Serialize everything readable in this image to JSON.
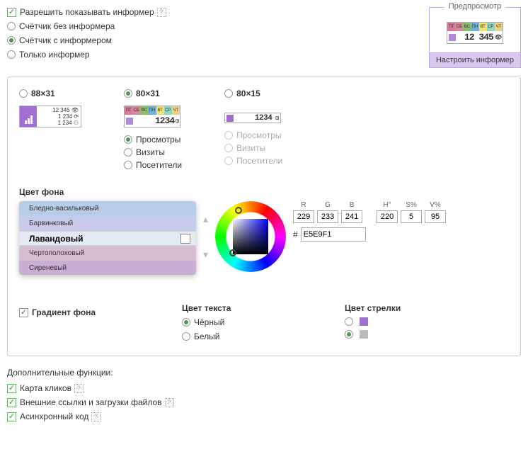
{
  "top": {
    "allow_informer": "Разрешить показывать информер",
    "counter_no_informer": "Счётчик без информера",
    "counter_with_informer": "Счётчик с информером",
    "informer_only": "Только информер"
  },
  "preview": {
    "title": "Предпросмотр",
    "number": "12 345",
    "days": [
      "ПТ",
      "СБ",
      "ВС",
      "ПН",
      "ВТ",
      "СР",
      "ЧТ"
    ],
    "day_colors": [
      "#d87aa0",
      "#d8889b",
      "#8cbf6a",
      "#6fb0d8",
      "#f5e26a",
      "#8fd8c8",
      "#f0d080"
    ],
    "button": "Настроить информер"
  },
  "sizes": {
    "s88": {
      "label": "88×31",
      "vals": [
        "12 345 👁",
        "1 234 ⟳",
        "1 234 ⚇"
      ]
    },
    "s80x31": {
      "label": "80×31",
      "number": "1234"
    },
    "s80x15": {
      "label": "80×15",
      "number": "1234"
    }
  },
  "metrics": {
    "views": "Просмотры",
    "visits": "Визиты",
    "visitors": "Посетители"
  },
  "bg": {
    "label": "Цвет фона",
    "swatches": [
      {
        "name": "Бледно-васильковый",
        "color": "#b6cce8"
      },
      {
        "name": "Барвинковый",
        "color": "#c7cceb"
      },
      {
        "name": "Лавандовый",
        "color": "#e5e9f1",
        "selected": true
      },
      {
        "name": "Чертополоховый",
        "color": "#d8bed3"
      },
      {
        "name": "Сиреневый",
        "color": "#c9aed4"
      }
    ],
    "rgb": {
      "r": "229",
      "g": "233",
      "b": "241"
    },
    "hsv": {
      "h": "220",
      "s": "5",
      "v": "95"
    },
    "labels": {
      "r": "R",
      "g": "G",
      "b": "B",
      "h": "H°",
      "s": "S%",
      "v": "V%"
    },
    "hex": "E5E9F1"
  },
  "bottom": {
    "gradient": "Градиент фона",
    "text_color": "Цвет текста",
    "black": "Чёрный",
    "white": "Белый",
    "arrow_color": "Цвет стрелки"
  },
  "footer": {
    "title": "Дополнительные функции:",
    "clickmap": "Карта кликов",
    "external": "Внешние ссылки и загрузки файлов",
    "async": "Асинхронный код"
  }
}
